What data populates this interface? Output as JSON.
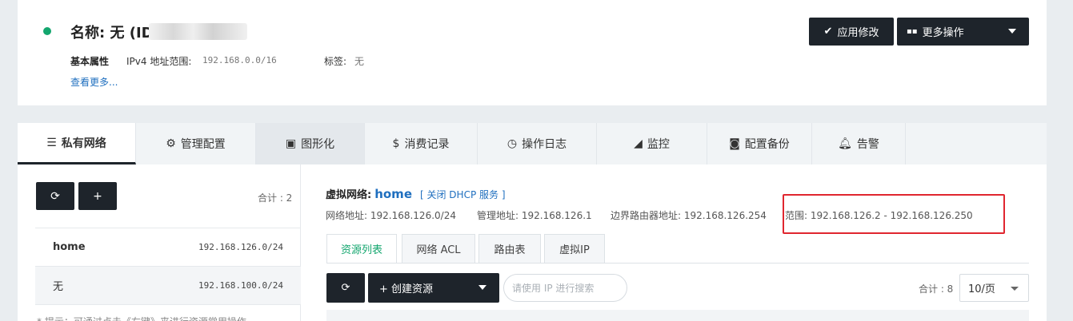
{
  "header": {
    "title_prefix": "名称: 无 (ID",
    "attr_heading": "基本属性",
    "ipv4_label": "IPv4 地址范围:",
    "ipv4_value": "192.168.0.0/16",
    "tag_label": "标签:",
    "tag_value": "无",
    "see_more": "查看更多...",
    "apply_label": "应用修改",
    "more_ops_label": "更多操作",
    "status_color": "#13a66e"
  },
  "tabs": [
    {
      "label": "私有网络",
      "icon": "list-icon"
    },
    {
      "label": "管理配置",
      "icon": "gears-icon"
    },
    {
      "label": "图形化",
      "icon": "image-icon"
    },
    {
      "label": "消费记录",
      "icon": "dollar-icon"
    },
    {
      "label": "操作日志",
      "icon": "clock-icon"
    },
    {
      "label": "监控",
      "icon": "area-chart-icon"
    },
    {
      "label": "配置备份",
      "icon": "camera-icon"
    },
    {
      "label": "告警",
      "icon": "bell-icon"
    }
  ],
  "sidebar": {
    "add_label": "+",
    "total": "合计 : 2",
    "items": [
      {
        "name": "home",
        "cidr": "192.168.126.0/24"
      },
      {
        "name": "无",
        "cidr": "192.168.100.0/24"
      }
    ],
    "hint": "* 提示：可通过点击《右键》来进行资源常用操作"
  },
  "detail": {
    "vnet_label": "虚拟网络:",
    "vnet_name": "home",
    "dhcp_action": "[ 关闭 DHCP 服务 ]",
    "network_addr": "网络地址: 192.168.126.0/24",
    "mgmt_addr": "管理地址: 192.168.126.1",
    "border_router": "边界路由器地址: 192.168.126.254",
    "range": "范围: 192.168.126.2 - 192.168.126.250",
    "subtabs": [
      "资源列表",
      "网络 ACL",
      "路由表",
      "虚拟IP"
    ],
    "create_label": "+ 创建资源",
    "search_placeholder": "请使用 IP 进行搜索",
    "search_value": "",
    "total": "合计 : 8",
    "page_size": "10/页",
    "highlight_color": "#e0262f"
  }
}
